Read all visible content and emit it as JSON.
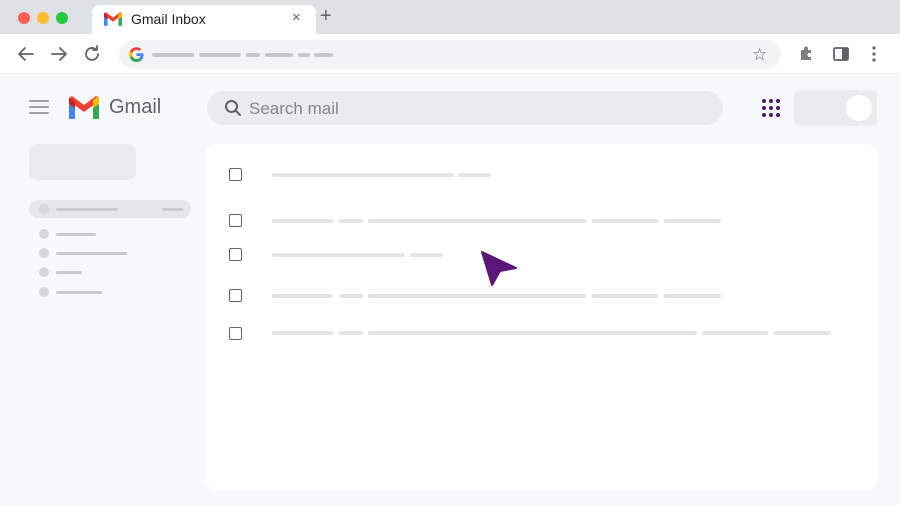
{
  "browser": {
    "tab_title": "Gmail Inbox",
    "tab_close_glyph": "×",
    "new_tab_glyph": "+",
    "star_glyph": "☆"
  },
  "gmail": {
    "logo_text": "Gmail",
    "search_placeholder": "Search mail"
  },
  "colors": {
    "cursor": "#5b1778",
    "apps_dots": "#4a1a6b",
    "chrome_bg": "#dee1e6",
    "page_bg": "#f6f8fc"
  },
  "icons": [
    "gmail-logo-icon",
    "close-icon",
    "back-arrow-icon",
    "forward-arrow-icon",
    "reload-icon",
    "google-g-icon",
    "star-icon",
    "extensions-icon",
    "side-panel-icon",
    "more-vert-icon",
    "menu-icon",
    "search-icon",
    "apps-grid-icon",
    "cursor-icon"
  ]
}
